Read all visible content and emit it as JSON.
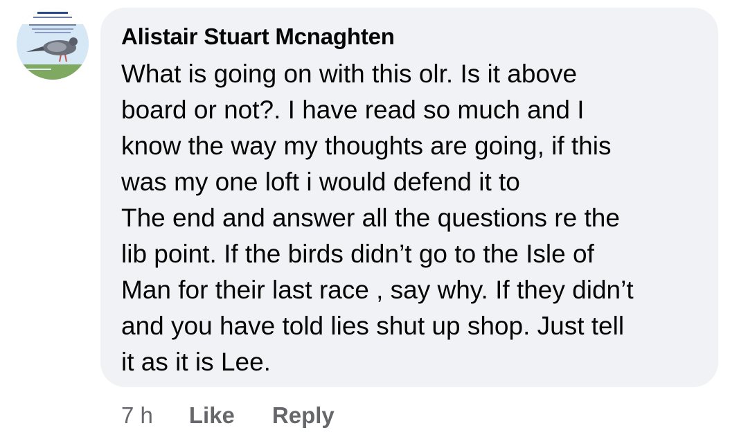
{
  "comment": {
    "author": "Alistair Stuart Mcnaghten",
    "lines": [
      "What is going on with this olr. Is it above",
      "board or not?. I have read so much and I",
      "know the way my thoughts are going, if this",
      "was my one loft i would defend it to",
      "The end and answer all the questions re the",
      "lib point. If the birds didn’t go to the Isle of",
      "Man for their last race , say why. If they didn’t",
      "and you have told lies shut up shop. Just tell",
      "it as it is Lee."
    ]
  },
  "actions": {
    "time": "7 h",
    "like_label": "Like",
    "reply_label": "Reply"
  },
  "colors": {
    "bubble": "#f0f2f5",
    "text": "#050505",
    "muted": "#65676b"
  },
  "icons": {
    "avatar": "pigeon-photo-avatar"
  }
}
